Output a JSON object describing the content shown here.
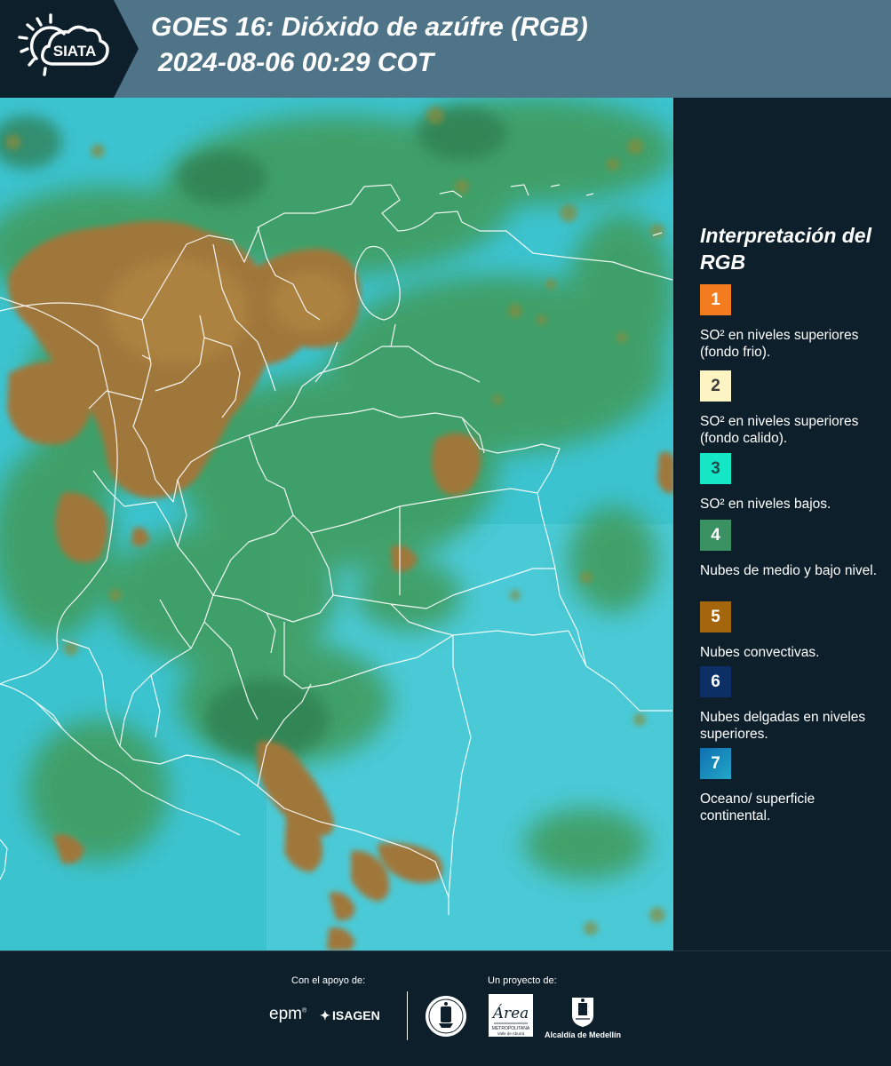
{
  "header": {
    "logo_text": "SIATA",
    "title_line1": "GOES 16: Dióxido de azúfre (RGB)",
    "title_line2": "2024-08-06 00:29 COT"
  },
  "map": {
    "image": "GOES-16 sulfur dioxide RGB composite over Colombia with white administrative boundaries",
    "colors": {
      "background_cyan": "#39c6d3",
      "green_clouds": "#3b9a5d",
      "convective_brown": "#a0773a",
      "boundaries": "#ffffff"
    }
  },
  "legend": {
    "title": "Interpretación del RGB",
    "items": [
      {
        "number": "1",
        "color": "#f37d1e",
        "num_color": "#ffffff",
        "text": "SO² en niveles superiores (fondo frio)."
      },
      {
        "number": "2",
        "color": "#fdf4c4",
        "num_color": "#3a3a3a",
        "text": "SO² en niveles superiores (fondo calido)."
      },
      {
        "number": "3",
        "color": "#14e6c6",
        "num_color": "#1e4c4a",
        "text": "SO² en niveles bajos."
      },
      {
        "number": "4",
        "color": "#3a9262",
        "num_color": "#ffffff",
        "text": "Nubes de medio y bajo nivel."
      },
      {
        "number": "5",
        "color": "#a3660c",
        "num_color": "#ffffff",
        "text": "Nubes convectivas."
      },
      {
        "number": "6",
        "color": "#0c2f66",
        "num_color": "#ffffff",
        "text": "Nubes delgadas en niveles superiores."
      },
      {
        "number": "7",
        "color": "#1a90bd",
        "num_color": "#ffffff",
        "text": "Oceano/ superficie continental."
      }
    ]
  },
  "footer": {
    "support_label": "Con el apoyo de:",
    "project_label": "Un proyecto de:",
    "sponsor1": "epm",
    "sponsor2": "ISAGEN",
    "area_caption": "METROPOLITANA",
    "area_caption2": "Valle de Aburrá",
    "alcaldia": "Alcaldía de Medellín"
  }
}
